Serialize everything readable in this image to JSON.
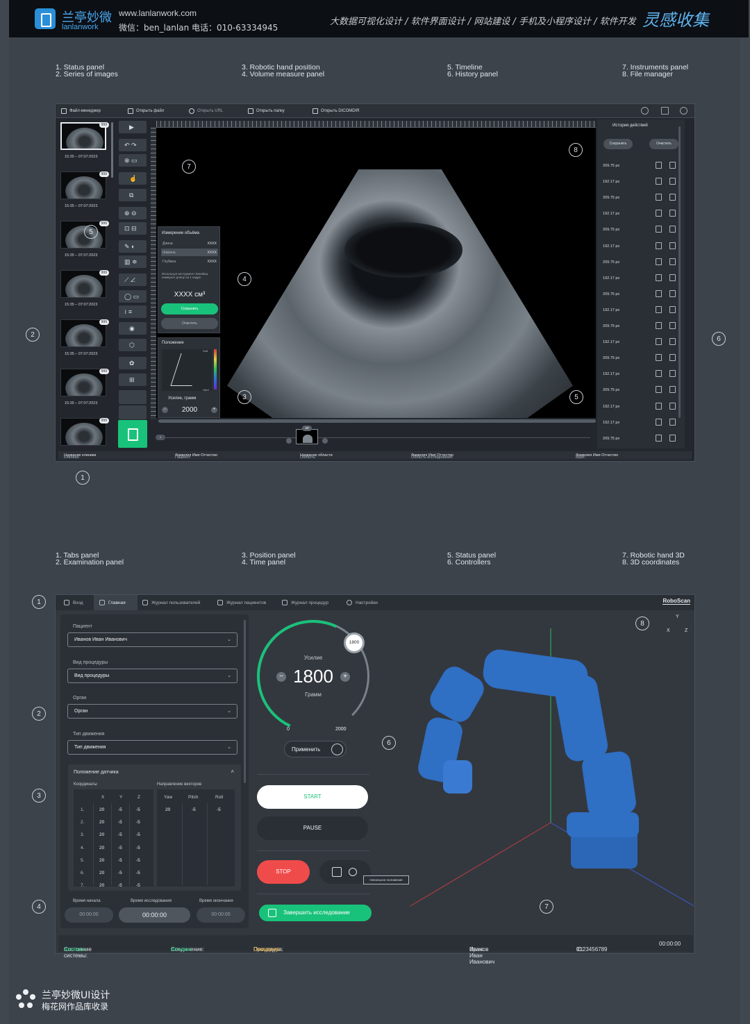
{
  "header": {
    "logo_cn": "兰亭妙微",
    "logo_en": "lanlanwork",
    "site": "www.lanlanwork.com",
    "contact": "微信：ben_lanlan    电话：010-63334945",
    "services": "大数据可视化设计 / 软件界面设计 / 网站建设 / 手机及小程序设计 / 软件开发",
    "brand": "灵感收集"
  },
  "legend1": {
    "col1": [
      "1. Status panel",
      "2. Series of images"
    ],
    "col2": [
      "3. Robotic hand position",
      "4. Volume measure panel"
    ],
    "col3": [
      "5. Timeline",
      "6. History panel"
    ],
    "col4": [
      "7. Instruments panel",
      "8. File manager"
    ]
  },
  "legend2": {
    "col1": [
      "1. Tabs panel",
      "2. Examination panel"
    ],
    "col2": [
      "3. Position panel",
      "4. Time panel"
    ],
    "col3": [
      "5. Status panel",
      "6. Controllers"
    ],
    "col4": [
      "7. Robotic hand 3D",
      "8. 3D coordinates"
    ]
  },
  "markers1": [
    "1",
    "2",
    "3",
    "4",
    "5",
    "6",
    "7",
    "8",
    "5"
  ],
  "markers2": [
    "1",
    "2",
    "3",
    "4",
    "6",
    "7",
    "8"
  ],
  "screen1": {
    "toolbar": [
      "Файл-менеджер",
      "Открыть файл",
      "Открыть URL",
      "Открыть папку",
      "Открыть DICOMDIR"
    ],
    "thumbs": [
      {
        "badge": "999",
        "time": "15:35 – 07:07:2023"
      },
      {
        "badge": "999",
        "time": "15:35 – 07:07:2023"
      },
      {
        "badge": "999",
        "time": "15:35 – 07:07:2023"
      },
      {
        "badge": "999",
        "time": "15:35 – 07:07:2023"
      },
      {
        "badge": "999",
        "time": "15:35 – 07:07:2023"
      },
      {
        "badge": "999",
        "time": "15:35 – 07:07:2023"
      },
      {
        "badge": "999",
        "time": ""
      }
    ],
    "tool_glyphs": [
      "▶",
      "↶ ↷",
      "⊗ ▭",
      "☝",
      "⧉",
      "⊕ ⊖",
      "⊡ ⊟",
      "✎ ◐",
      "▥ ≑",
      "⟋ ∠",
      "◯ ▭",
      "≀ ≡",
      "◉",
      "⬡",
      "✿",
      "⊞"
    ],
    "volume": {
      "title": "Измерение объёма",
      "rows": [
        [
          "Длина",
          "XXXX"
        ],
        [
          "Ширина",
          "XXXX"
        ],
        [
          "Глубина",
          "XXXX"
        ]
      ],
      "note": "Используя инструмент Линейка, измерьте длину на 1 кадре",
      "value": "XXXX см³",
      "save": "Сохранить",
      "clear": "Очистить"
    },
    "position": {
      "title": "Положение",
      "soft": "Soft",
      "hard": "Hard",
      "force_label": "Усилие, грамм",
      "force": "2000",
      "minus": "−",
      "plus": "+"
    },
    "history": {
      "title": "История действий",
      "save": "Сохранить",
      "clear": "Очистить",
      "rows": [
        "209.75 px",
        "192.17 px",
        "209.75 px",
        "192.17 px",
        "209.75 px",
        "192.17 px",
        "209.75 px",
        "192.17 px",
        "209.75 px",
        "192.17 px",
        "209.75 px",
        "192.17 px",
        "209.75 px",
        "192.17 px",
        "209.75 px",
        "192.17 px",
        "192.17 px",
        "209.75 px"
      ]
    },
    "timeline": {
      "start": "0",
      "frame": "20"
    },
    "status": [
      {
        "k": "Клиника:",
        "v": "Название клиники"
      },
      {
        "k": "Пациент:",
        "v": "Фамилия Имя Отчество"
      },
      {
        "k": "Область:",
        "v": "Название области"
      },
      {
        "k": "Область исследования:",
        "v": "Фамилия Имя Отчество"
      },
      {
        "k": "Врач:",
        "v": "Фамилия Имя Отчество"
      }
    ]
  },
  "screen2": {
    "tabs": [
      "Вход",
      "Главная",
      "Журнал пользователей",
      "Журнал пациентов",
      "Журнал процедур",
      "Настройки"
    ],
    "brand": "RoboScan",
    "exam": [
      {
        "label": "Пациент",
        "value": "Иванов Иван Иванович"
      },
      {
        "label": "Вид процедуры",
        "value": "Вид процедуры"
      },
      {
        "label": "Орган",
        "value": "Орган"
      },
      {
        "label": "Тип движения",
        "value": "Тип движения"
      }
    ],
    "caret": "⌄",
    "position": {
      "title": "Положение датчика",
      "caret": "˄",
      "coords_label": "Координаты",
      "vectors_label": "Направление векторов",
      "coord_headers": [
        "X",
        "Y",
        "Z"
      ],
      "vector_headers": [
        "Yaw",
        "Pitch",
        "Roll"
      ],
      "coords": [
        {
          "n": "1.",
          "x": "20",
          "y": "-5",
          "z": "-5"
        },
        {
          "n": "2.",
          "x": "20",
          "y": "-5",
          "z": "-5"
        },
        {
          "n": "3.",
          "x": "20",
          "y": "-5",
          "z": "-5"
        },
        {
          "n": "4.",
          "x": "20",
          "y": "-5",
          "z": "-5"
        },
        {
          "n": "5.",
          "x": "20",
          "y": "-5",
          "z": "-5"
        },
        {
          "n": "6.",
          "x": "20",
          "y": "-5",
          "z": "-5"
        },
        {
          "n": "7.",
          "x": "20",
          "y": "-5",
          "z": "-5"
        }
      ],
      "vector": {
        "yaw": "20",
        "pitch": "-5",
        "roll": "-5"
      }
    },
    "times": {
      "start_label": "Время начала",
      "exam_label": "Время исследования",
      "end_label": "Время окончания",
      "start": "00:00:00",
      "exam": "00:00:00",
      "end": "00:00:00"
    },
    "gauge": {
      "knob": "1800",
      "label": "Усилие",
      "value": "1800",
      "unit": "Грамм",
      "min": "0",
      "max": "2000",
      "minus": "−",
      "plus": "+",
      "level": 0.9
    },
    "apply": "Применить",
    "start": "START",
    "pause": "PAUSE",
    "stop": "STOP",
    "tooltip": "Начальное положение",
    "finish": "Завершить исследование",
    "axes": {
      "y": "Y",
      "x": "X",
      "z": "Z"
    },
    "status": {
      "system_label": "Состояние системы:",
      "system": "Активно",
      "conn_label": "Соединение:",
      "conn": "Активно",
      "proc_label": "Процедура:",
      "proc": "Ожидание",
      "doctor_label": "Врач:",
      "doctor": "Иванов Иван Иванович",
      "id_label": "ID:",
      "id": "0123456789",
      "time": "00:00:00"
    },
    "colors": {
      "accent": "#19c27a",
      "stop": "#f04b4b",
      "waiting": "#f2b233",
      "robot": "#2f6fc4"
    }
  },
  "footer": {
    "line1": "兰亭妙微UI设计",
    "line2": "梅花网作品库收录"
  }
}
